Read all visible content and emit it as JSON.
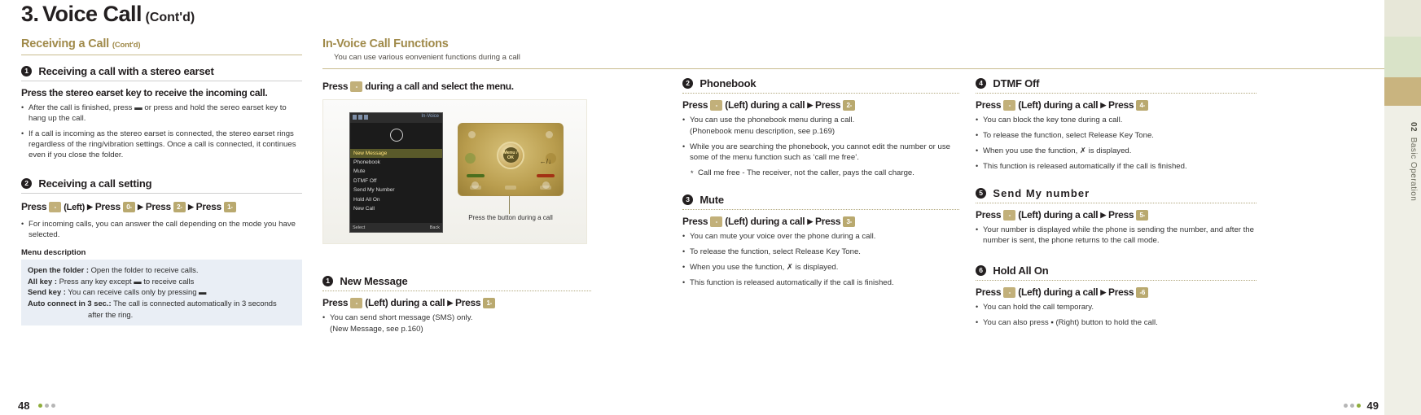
{
  "page": {
    "chapter_num": "3.",
    "chapter_title": "Voice Call",
    "chapter_cont": "(Cont'd)",
    "folio_left": "48",
    "folio_right": "49",
    "edge_tab_num": "02",
    "edge_tab_label": "Basic Operation"
  },
  "left": {
    "section_title": "Receiving a Call",
    "section_title_small": "(Cont'd)",
    "item1": {
      "badge": "1",
      "heading": "Receiving a call with a stereo earset",
      "bold_line": "Press the stereo earset key to receive the incoming call.",
      "bullets": [
        "After the call is finished, press ▬ or press and hold the sereo earset key to hang up the call.",
        "If a call is incoming as the stereo earset is connected, the stereo earset rings regardless of the ring/vibration settings.  Once a call is connected, it continues even if you close the folder."
      ]
    },
    "item2": {
      "badge": "2",
      "heading": "Receiving a call setting",
      "press_line": {
        "press1": "Press",
        "key1": "-",
        "left_label": "(Left)",
        "press2": "Press",
        "key2": "0-",
        "press3": "Press",
        "key3": "2-",
        "press4": "Press",
        "key4": "1-"
      },
      "bullets": [
        "For incoming calls, you can answer the call depending on the mode you have selected."
      ]
    },
    "menu_description_label": "Menu description",
    "menu_rows": [
      {
        "term": "Open the folder :",
        "desc": "Open the folder to receive calls."
      },
      {
        "term": "All key :",
        "desc": "Press any key except ▬ to receive calls"
      },
      {
        "term": "Send key :",
        "desc": "You can receive calls only by pressing ▬"
      },
      {
        "term": "Auto connect in 3 sec.:",
        "desc": "The call is connected automatically in 3 seconds"
      },
      {
        "term": "",
        "desc": "after the ring."
      }
    ]
  },
  "invoice": {
    "section_title": "In-Voice Call Functions",
    "section_sub": "You can use various eonvenient functions during a call",
    "press_menu_line": {
      "pre": "Press",
      "key": "-",
      "post": "during a call and select the menu."
    },
    "phone": {
      "lcd_title": "In-Voice",
      "menu_items": [
        "New Message",
        "Phonebook",
        "Mute",
        "DTMF Off",
        "Send My Number",
        "Hold All On",
        "New Call"
      ],
      "selected_index": 0,
      "soft_left": "Select",
      "soft_right": "Back",
      "ok_label": "Menu / OK"
    },
    "caption": "Press the button during a call",
    "item1": {
      "badge": "1",
      "heading": "New Message",
      "press": {
        "p1": "Press",
        "k1": "-",
        "left": "(Left) during a call",
        "arrow": "▶",
        "p2": "Press",
        "k2": "1-"
      },
      "bullets": [
        "You can send short message (SMS) only.",
        "(New Message, see p.160)"
      ]
    }
  },
  "col3": {
    "item2": {
      "badge": "2",
      "heading": "Phonebook",
      "press": {
        "p1": "Press",
        "k1": "-",
        "left": "(Left) during a call",
        "arrow": "▶",
        "p2": "Press",
        "k2": "2-"
      },
      "bullets": [
        "You can use the phonebook menu during a call.",
        "(Phonebook menu description, see p.169)",
        "While you are searching the phonebook, you cannot edit the number or use some of the menu function such as ‘call me free’.",
        "Call me free - The receiver, not the caller, pays the call charge."
      ]
    },
    "item3": {
      "badge": "3",
      "heading": "Mute",
      "press": {
        "p1": "Press",
        "k1": "-",
        "left": "(Left) during a call",
        "arrow": "▶",
        "p2": "Press",
        "k2": "3-"
      },
      "bullets": [
        "You can mute your voice over the phone during a call.",
        "To release the function, select Release Key Tone.",
        "When you use the function,  ✗  is displayed.",
        "This function is released automatically if the call is finished."
      ]
    }
  },
  "col4": {
    "item4": {
      "badge": "4",
      "heading": "DTMF Off",
      "press": {
        "p1": "Press",
        "k1": "-",
        "left": "(Left) during a call",
        "arrow": "▶",
        "p2": "Press",
        "k2": "4-"
      },
      "bullets": [
        "You can block the key tone during a call.",
        "To release the function, select Release Key Tone.",
        "When you use the function,  ✗  is displayed.",
        "This function is released automatically if the call is finished."
      ]
    },
    "item5": {
      "badge": "5",
      "heading": "Send  My number",
      "press": {
        "p1": "Press",
        "k1": "-",
        "left": "(Left) during a call",
        "arrow": "▶",
        "p2": "Press",
        "k2": "5-"
      },
      "bullets": [
        "Your number is displayed while the phone is sending the number, and after the number is sent, the phone returns to the call mode."
      ]
    },
    "item6": {
      "badge": "6",
      "heading": "Hold All On",
      "press": {
        "p1": "Press",
        "k1": "-",
        "left": "(Left) during a call",
        "arrow": "▶",
        "p2": "Press",
        "k2": "-6"
      },
      "bullets": [
        "You can hold the call temporary.",
        "You can also press ▪ (Right) button to hold the call."
      ]
    }
  }
}
